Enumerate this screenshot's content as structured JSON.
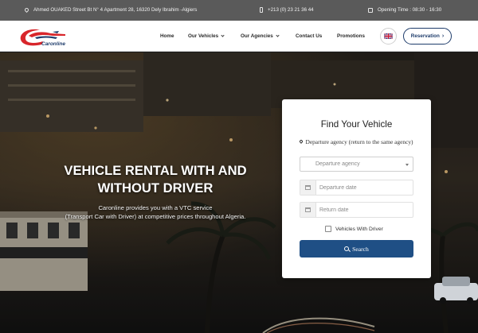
{
  "topbar": {
    "address": "Ahmed OUAKED Street Bt N° 4 Apartment 28, 16320 Dely Ibrahim -Algiers",
    "phone": "+213 (0) 23 21 36 44",
    "hours": "Opening Time : 08:30 - 16:30",
    "icons": [
      "map-pin-icon",
      "phone-icon",
      "calendar-icon"
    ]
  },
  "header": {
    "logo_text": "Caronline",
    "nav": [
      {
        "label": "Home",
        "dropdown": false
      },
      {
        "label": "Our Vehicles",
        "dropdown": true
      },
      {
        "label": "Our Agencies",
        "dropdown": true
      },
      {
        "label": "Contact Us",
        "dropdown": false
      },
      {
        "label": "Promotions",
        "dropdown": false
      }
    ],
    "language_flag": "uk-flag-icon",
    "reservation_label": "Reservation"
  },
  "hero": {
    "title_line1": "VEHICLE RENTAL WITH AND",
    "title_line2": "WITHOUT DRIVER",
    "subtitle_line1": "Caronline provides you with a VTC service",
    "subtitle_line2": "(Transport Car with Driver) at competitive prices throughout Algeria."
  },
  "booking": {
    "title": "Find Your Vehicle",
    "agency_label": "Departure agency (return to the same agency)",
    "agency_select_value": "Departure agency",
    "departure_date_placeholder": "Departure date",
    "return_date_placeholder": "Return date",
    "with_driver_label": "Vehicles With Driver",
    "with_driver_checked": false,
    "search_label": "Search"
  },
  "colors": {
    "topbar_bg": "#5a5a5a",
    "brand_red": "#d8262b",
    "brand_navy": "#1e3c6b",
    "search_button": "#1f4f85"
  }
}
